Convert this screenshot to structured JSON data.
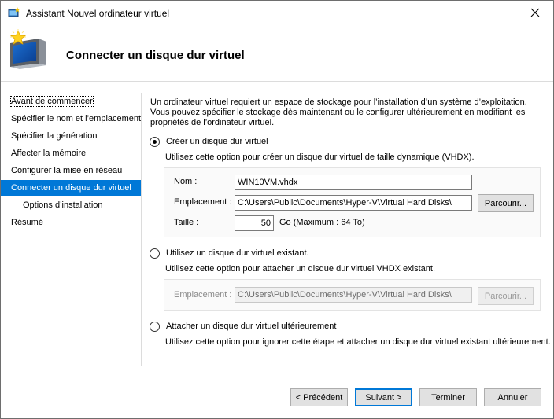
{
  "window": {
    "title": "Assistant Nouvel ordinateur virtuel"
  },
  "header": {
    "title": "Connecter un disque dur virtuel"
  },
  "sidebar": {
    "items": [
      {
        "label": "Avant de commencer"
      },
      {
        "label": "Spécifier le nom et l’emplacement"
      },
      {
        "label": "Spécifier la génération"
      },
      {
        "label": "Affecter la mémoire"
      },
      {
        "label": "Configurer la mise en réseau"
      },
      {
        "label": "Connecter un disque dur virtuel"
      },
      {
        "label": "Options d’installation"
      },
      {
        "label": "Résumé"
      }
    ]
  },
  "main": {
    "intro": "Un ordinateur virtuel requiert un espace de stockage pour l’installation d’un système d’exploitation. Vous pouvez spécifier le stockage dès maintenant ou le configurer ultérieurement en modifiant les propriétés de l’ordinateur virtuel.",
    "create": {
      "label": "Créer un disque dur virtuel",
      "desc": "Utilisez cette option pour créer un disque dur virtuel de taille dynamique (VHDX).",
      "name_label": "Nom :",
      "name_value": "WIN10VM.vhdx",
      "location_label": "Emplacement :",
      "location_value": "C:\\Users\\Public\\Documents\\Hyper-V\\Virtual Hard Disks\\",
      "browse_label": "Parcourir...",
      "size_label": "Taille :",
      "size_value": "50",
      "size_unit": "Go (Maximum : 64 To)"
    },
    "existing": {
      "label": "Utilisez un disque dur virtuel existant.",
      "desc": "Utilisez cette option pour attacher un disque dur virtuel VHDX existant.",
      "location_label": "Emplacement :",
      "location_value": "C:\\Users\\Public\\Documents\\Hyper-V\\Virtual Hard Disks\\",
      "browse_label": "Parcourir..."
    },
    "later": {
      "label": "Attacher un disque dur virtuel ultérieurement",
      "desc": "Utilisez cette option pour ignorer cette étape et attacher un disque dur virtuel existant ultérieurement."
    }
  },
  "footer": {
    "previous": "< Précédent",
    "next": "Suivant >",
    "finish": "Terminer",
    "cancel": "Annuler"
  },
  "colors": {
    "accent": "#0078d7"
  },
  "icons": {
    "app": "hyper-v-wizard-icon",
    "header": "computer-monitor-star-icon",
    "close": "close-icon"
  }
}
